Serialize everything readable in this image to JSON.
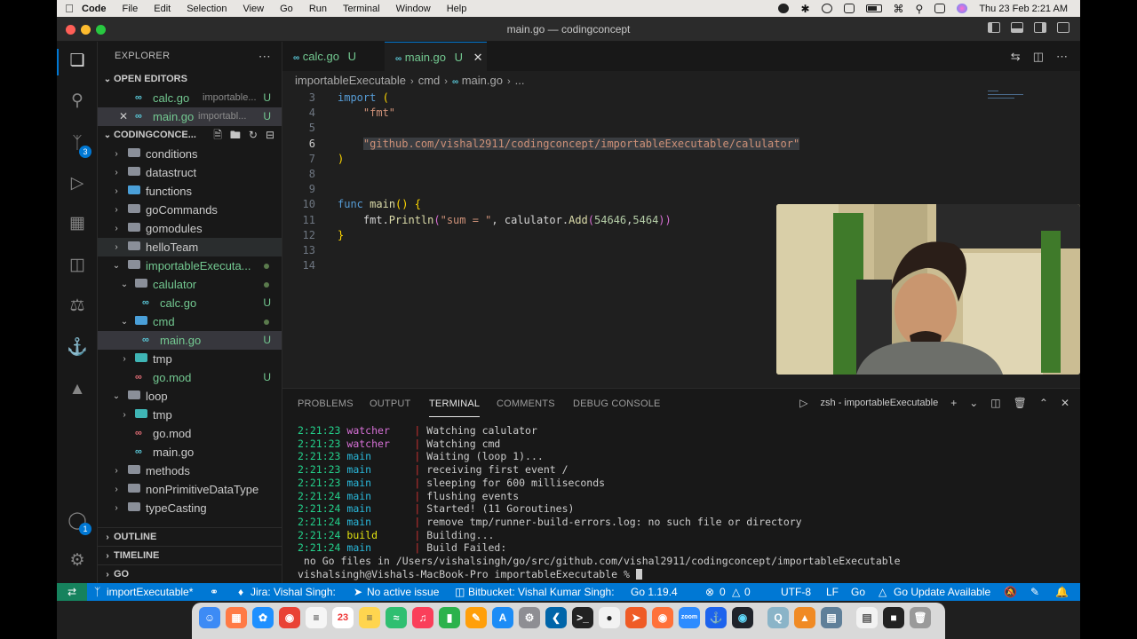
{
  "menubar": {
    "app": "Code",
    "items": [
      "File",
      "Edit",
      "Selection",
      "View",
      "Go",
      "Run",
      "Terminal",
      "Window",
      "Help"
    ],
    "clock": "Thu 23 Feb  2:21 AM"
  },
  "window": {
    "title": "main.go — codingconcept"
  },
  "activity": {
    "scm_badge": "3",
    "account_badge": "1"
  },
  "sidebar": {
    "header": "EXPLORER",
    "open_editors": {
      "label": "OPEN EDITORS",
      "items": [
        {
          "name": "calc.go",
          "desc": "importable...",
          "status": "U"
        },
        {
          "name": "main.go",
          "desc": "importabl...",
          "status": "U"
        }
      ]
    },
    "workspace": {
      "label": "CODINGCONCE...",
      "tree": [
        {
          "name": "conditions"
        },
        {
          "name": "datastruct"
        },
        {
          "name": "functions"
        },
        {
          "name": "goCommands"
        },
        {
          "name": "gomodules"
        },
        {
          "name": "helloTeam"
        },
        {
          "name": "importableExecuta..."
        },
        {
          "name": "calulator"
        },
        {
          "name": "calc.go",
          "status": "U"
        },
        {
          "name": "cmd"
        },
        {
          "name": "main.go",
          "status": "U"
        },
        {
          "name": "tmp"
        },
        {
          "name": "go.mod",
          "status": "U"
        },
        {
          "name": "loop"
        },
        {
          "name": "tmp"
        },
        {
          "name": "go.mod"
        },
        {
          "name": "main.go"
        },
        {
          "name": "methods"
        },
        {
          "name": "nonPrimitiveDataType"
        },
        {
          "name": "typeCasting"
        }
      ]
    },
    "bottom_sections": [
      "OUTLINE",
      "TIMELINE",
      "GO"
    ]
  },
  "editor": {
    "tabs": [
      {
        "name": "calc.go",
        "status": "U"
      },
      {
        "name": "main.go",
        "status": "U"
      }
    ],
    "breadcrumb": [
      "importableExecutable",
      "cmd",
      "main.go",
      "..."
    ],
    "lines": [
      {
        "n": "3",
        "tokens": [
          [
            "kw",
            "import"
          ],
          [
            "pl",
            " "
          ],
          [
            "brk",
            "("
          ]
        ]
      },
      {
        "n": "4",
        "tokens": [
          [
            "pl",
            "    "
          ],
          [
            "str",
            "\"fmt\""
          ]
        ]
      },
      {
        "n": "5",
        "tokens": []
      },
      {
        "n": "6",
        "tokens": [
          [
            "pl",
            "    "
          ],
          [
            "str hl",
            "\"github.com/vishal2911/codingconcept/importableExecutable/calulator\""
          ]
        ]
      },
      {
        "n": "7",
        "tokens": [
          [
            "brk",
            ")"
          ]
        ]
      },
      {
        "n": "8",
        "tokens": []
      },
      {
        "n": "9",
        "tokens": []
      },
      {
        "n": "10",
        "tokens": [
          [
            "kw",
            "func"
          ],
          [
            "pl",
            " "
          ],
          [
            "fn",
            "main"
          ],
          [
            "brk",
            "()"
          ],
          [
            "pl",
            " "
          ],
          [
            "brk",
            "{"
          ]
        ]
      },
      {
        "n": "11",
        "tokens": [
          [
            "pl",
            "    fmt."
          ],
          [
            "fn",
            "Println"
          ],
          [
            "brk2",
            "("
          ],
          [
            "str",
            "\"sum = \""
          ],
          [
            "pl",
            ", calulator."
          ],
          [
            "fn",
            "Add"
          ],
          [
            "brk2",
            "("
          ],
          [
            "num-lit",
            "54646"
          ],
          [
            "pl",
            ","
          ],
          [
            "num-lit",
            "5464"
          ],
          [
            "brk2",
            "))"
          ]
        ]
      },
      {
        "n": "12",
        "tokens": [
          [
            "brk",
            "}"
          ]
        ]
      },
      {
        "n": "13",
        "tokens": []
      },
      {
        "n": "14",
        "tokens": []
      }
    ]
  },
  "panel": {
    "tabs": [
      "PROBLEMS",
      "OUTPUT",
      "TERMINAL",
      "COMMENTS",
      "DEBUG CONSOLE"
    ],
    "active_tab": "TERMINAL",
    "terminal_name": "zsh - importableExecutable",
    "log": [
      {
        "time": "2:21:23",
        "src": "watcher",
        "msg": "Watching calulator"
      },
      {
        "time": "2:21:23",
        "src": "watcher",
        "msg": "Watching cmd"
      },
      {
        "time": "2:21:23",
        "src": "main",
        "msg": "Waiting (loop 1)..."
      },
      {
        "time": "2:21:23",
        "src": "main",
        "msg": "receiving first event /"
      },
      {
        "time": "2:21:23",
        "src": "main",
        "msg": "sleeping for 600 milliseconds"
      },
      {
        "time": "2:21:24",
        "src": "main",
        "msg": "flushing events"
      },
      {
        "time": "2:21:24",
        "src": "main",
        "msg": "Started! (11 Goroutines)"
      },
      {
        "time": "2:21:24",
        "src": "main",
        "msg": "remove tmp/runner-build-errors.log: no such file or directory"
      },
      {
        "time": "2:21:24",
        "src": "build",
        "msg": "Building..."
      },
      {
        "time": "2:21:24",
        "src": "main",
        "msg": "Build Failed:"
      }
    ],
    "error_line": " no Go files in /Users/vishalsingh/go/src/github.com/vishal2911/codingconcept/importableExecutable",
    "prompt": "vishalsingh@Vishals-MacBook-Pro importableExecutable % "
  },
  "statusbar": {
    "branch": "importExecutable*",
    "jira": "Jira: Vishal  Singh:",
    "issue": "No active issue",
    "bitbucket": "Bitbucket: Vishal Kumar Singh:",
    "go_version": "Go 1.19.4",
    "errors": "0",
    "warnings": "0",
    "encoding": "UTF-8",
    "eol": "LF",
    "language": "Go",
    "update": "Go Update Available"
  },
  "dock": {
    "calendar_day": "23"
  },
  "colors": {
    "accent": "#0078d4",
    "remote": "#16825d",
    "untracked": "#73c991"
  }
}
